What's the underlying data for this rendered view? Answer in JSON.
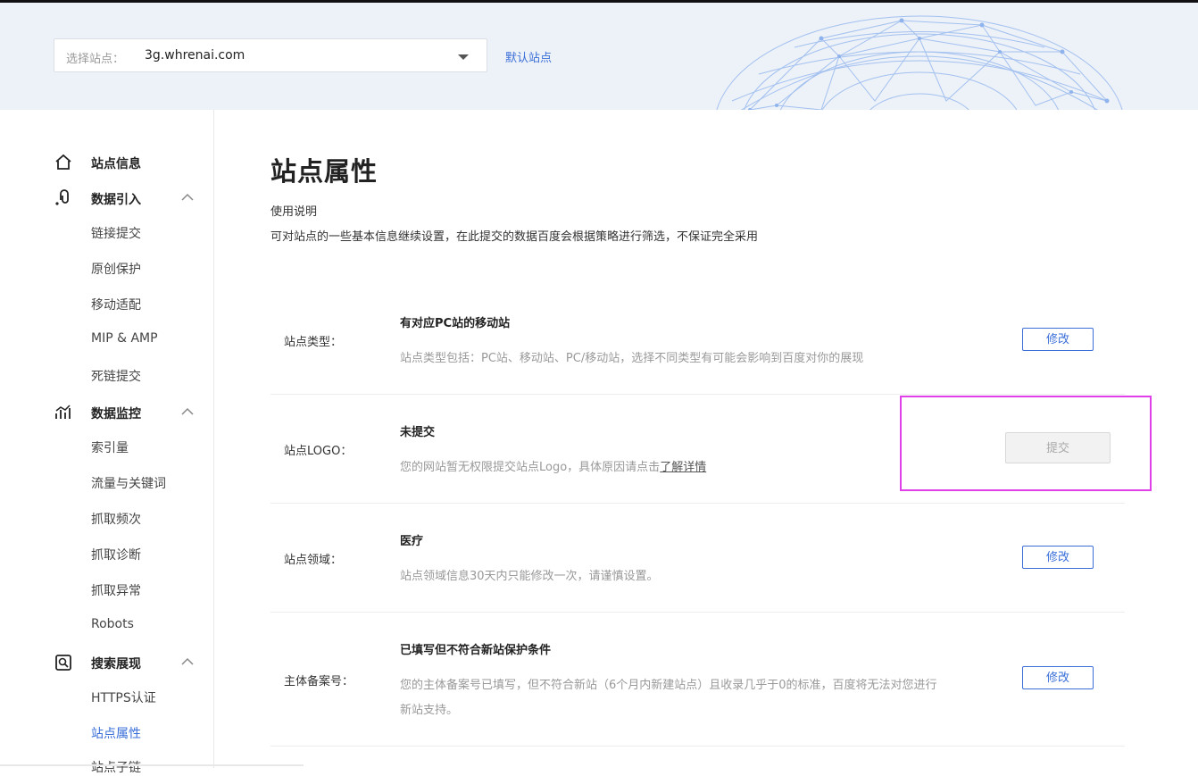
{
  "header": {
    "site_select_label": "选择站点：",
    "site_select_value": "3g.whrenai.com",
    "default_site_link": "默认站点"
  },
  "sidebar": {
    "groups": [
      {
        "label": "站点信息",
        "icon": "home-icon",
        "items": []
      },
      {
        "label": "数据引入",
        "icon": "data-import-icon",
        "items": [
          "链接提交",
          "原创保护",
          "移动适配",
          "MIP & AMP",
          "死链提交"
        ]
      },
      {
        "label": "数据监控",
        "icon": "data-monitor-icon",
        "items": [
          "索引量",
          "流量与关键词",
          "抓取频次",
          "抓取诊断",
          "抓取异常",
          "Robots"
        ]
      },
      {
        "label": "搜索展现",
        "icon": "search-display-icon",
        "items": [
          "HTTPS认证",
          "站点属性",
          "站点子链"
        ]
      }
    ],
    "active_item": "站点属性"
  },
  "main": {
    "title": "站点属性",
    "usage_title": "使用说明",
    "usage_desc": "可对站点的一些基本信息继续设置，在此提交的数据百度会根据策略进行筛选，不保证完全采用",
    "rows": [
      {
        "label": "站点类型：",
        "value": "有对应PC站的移动站",
        "desc": "站点类型包括：PC站、移动站、PC/移动站，选择不同类型有可能会影响到百度对你的展现",
        "button": "修改"
      },
      {
        "label": "站点LOGO：",
        "value": "未提交",
        "desc": "您的网站暂无权限提交站点Logo，具体原因请点击",
        "desc_link": "了解详情",
        "button": "提交"
      },
      {
        "label": "站点领域：",
        "value": "医疗",
        "desc": "站点领域信息30天内只能修改一次，请谨慎设置。",
        "button": "修改"
      },
      {
        "label": "主体备案号：",
        "value": "已填写但不符合新站保护条件",
        "desc_line1": "您的主体备案号已填写，但不符合新站（6个月内新建站点）且收录几乎于0的标准，百度将无法对您进行",
        "desc_line2": "新站支持。",
        "button": "修改"
      }
    ]
  },
  "colors": {
    "accent": "#3a6fd8",
    "highlight": "#e040e8",
    "header_bg": "#edf1f8"
  }
}
